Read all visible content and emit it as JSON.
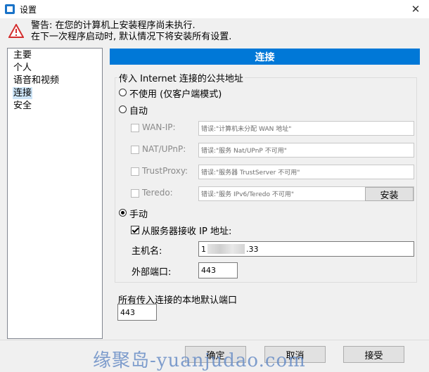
{
  "window": {
    "title": "设置"
  },
  "warning": {
    "line1": "警告: 在您的计算机上安装程序尚未执行.",
    "line2": "在下一次程序启动时, 默认情况下将安装所有设置."
  },
  "sidebar": {
    "items": [
      {
        "label": "主要",
        "selected": false
      },
      {
        "label": "个人",
        "selected": false
      },
      {
        "label": "语音和视频",
        "selected": false
      },
      {
        "label": "连接",
        "selected": true
      },
      {
        "label": "安全",
        "selected": false
      }
    ]
  },
  "panel": {
    "header": "连接",
    "public_group_label": "传入 Internet 连接的公共地址",
    "radio_none": "不使用 (仅客户端模式)",
    "radio_auto": "自动",
    "radio_manual": "手动",
    "auto_rows": [
      {
        "label": "WAN-IP:",
        "value": "错误:\"计算机未分配 WAN 地址\""
      },
      {
        "label": "NAT/UPnP:",
        "value": "错误:\"服务 Nat/UPnP 不可用\""
      },
      {
        "label": "TrustProxy:",
        "value": "错误:\"服务器 TrustServer 不可用\""
      },
      {
        "label": "Teredo:",
        "value": "错误:\"服务 IPv6/Teredo 不可用\""
      }
    ],
    "install_button": "安装",
    "receive_ip_label": "从服务器接收 IP 地址:",
    "host_label": "主机名:",
    "host_value_prefix": "1",
    "host_value_suffix": ".33",
    "ext_port_label": "外部端口:",
    "ext_port_value": "443",
    "local_port_label": "所有传入连接的本地默认端口",
    "local_port_value": "443"
  },
  "footer": {
    "ok": "确定",
    "cancel": "取消",
    "apply": "接受"
  },
  "watermark": "缘聚岛-yuanjudao.com",
  "colors": {
    "accent": "#0078d7",
    "warning": "#d32f2f",
    "selection": "#cce4f7"
  }
}
